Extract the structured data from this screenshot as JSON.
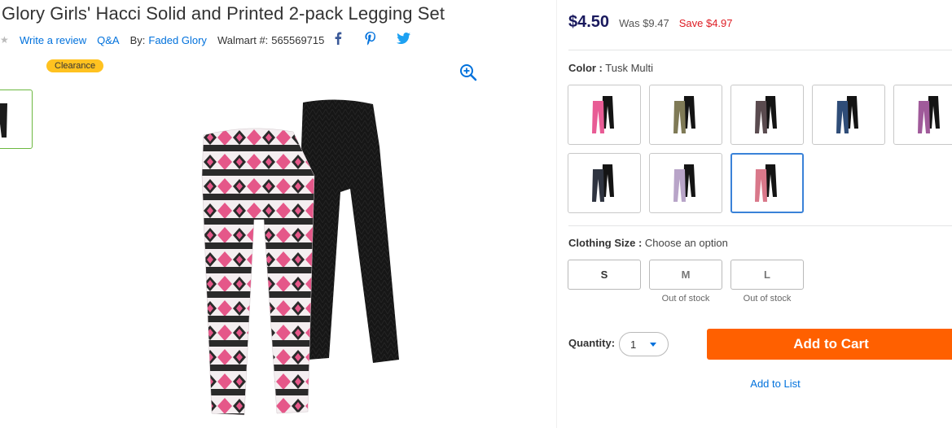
{
  "product": {
    "title": "Glory Girls' Hacci Solid and Printed 2-pack Legging Set",
    "write_review": "Write a review",
    "qa": "Q&A",
    "by_label": "By:",
    "brand": "Faded Glory",
    "walmart_label": "Walmart #:",
    "walmart_number": "565569715",
    "badge": "Clearance"
  },
  "pricing": {
    "price": "$4.50",
    "was": "Was $9.47",
    "save": "Save $4.97"
  },
  "color": {
    "label": "Color :",
    "value": "Tusk Multi",
    "swatches": [
      {
        "name": "pink-aztec",
        "print": "#e85c95"
      },
      {
        "name": "olive-camo",
        "print": "#7f7a56"
      },
      {
        "name": "black-fairisle",
        "print": "#5a4b4f"
      },
      {
        "name": "navy-denim",
        "print": "#2f4d78"
      },
      {
        "name": "purple-print",
        "print": "#a05a9a"
      },
      {
        "name": "black-dots",
        "print": "#2f3440"
      },
      {
        "name": "lavender-floral",
        "print": "#b8a4c8"
      },
      {
        "name": "tusk-multi",
        "print": "#d9788a"
      }
    ]
  },
  "size": {
    "label": "Clothing Size :",
    "value": "Choose an option",
    "options": [
      {
        "label": "S",
        "status": ""
      },
      {
        "label": "M",
        "status": "Out of stock"
      },
      {
        "label": "L",
        "status": "Out of stock"
      }
    ]
  },
  "quantity": {
    "label": "Quantity:",
    "value": "1"
  },
  "actions": {
    "add_to_cart": "Add to Cart",
    "add_to_list": "Add to List"
  },
  "colors": {
    "link": "#0071dc",
    "price": "#1a1a5e",
    "save": "#de1c24",
    "cta": "#ff6000",
    "badge": "#ffc220",
    "selected_border": "#3a82d8"
  },
  "icons": [
    "star-icon",
    "facebook-icon",
    "pinterest-icon",
    "twitter-icon",
    "zoom-in-icon",
    "chevron-down-icon"
  ]
}
